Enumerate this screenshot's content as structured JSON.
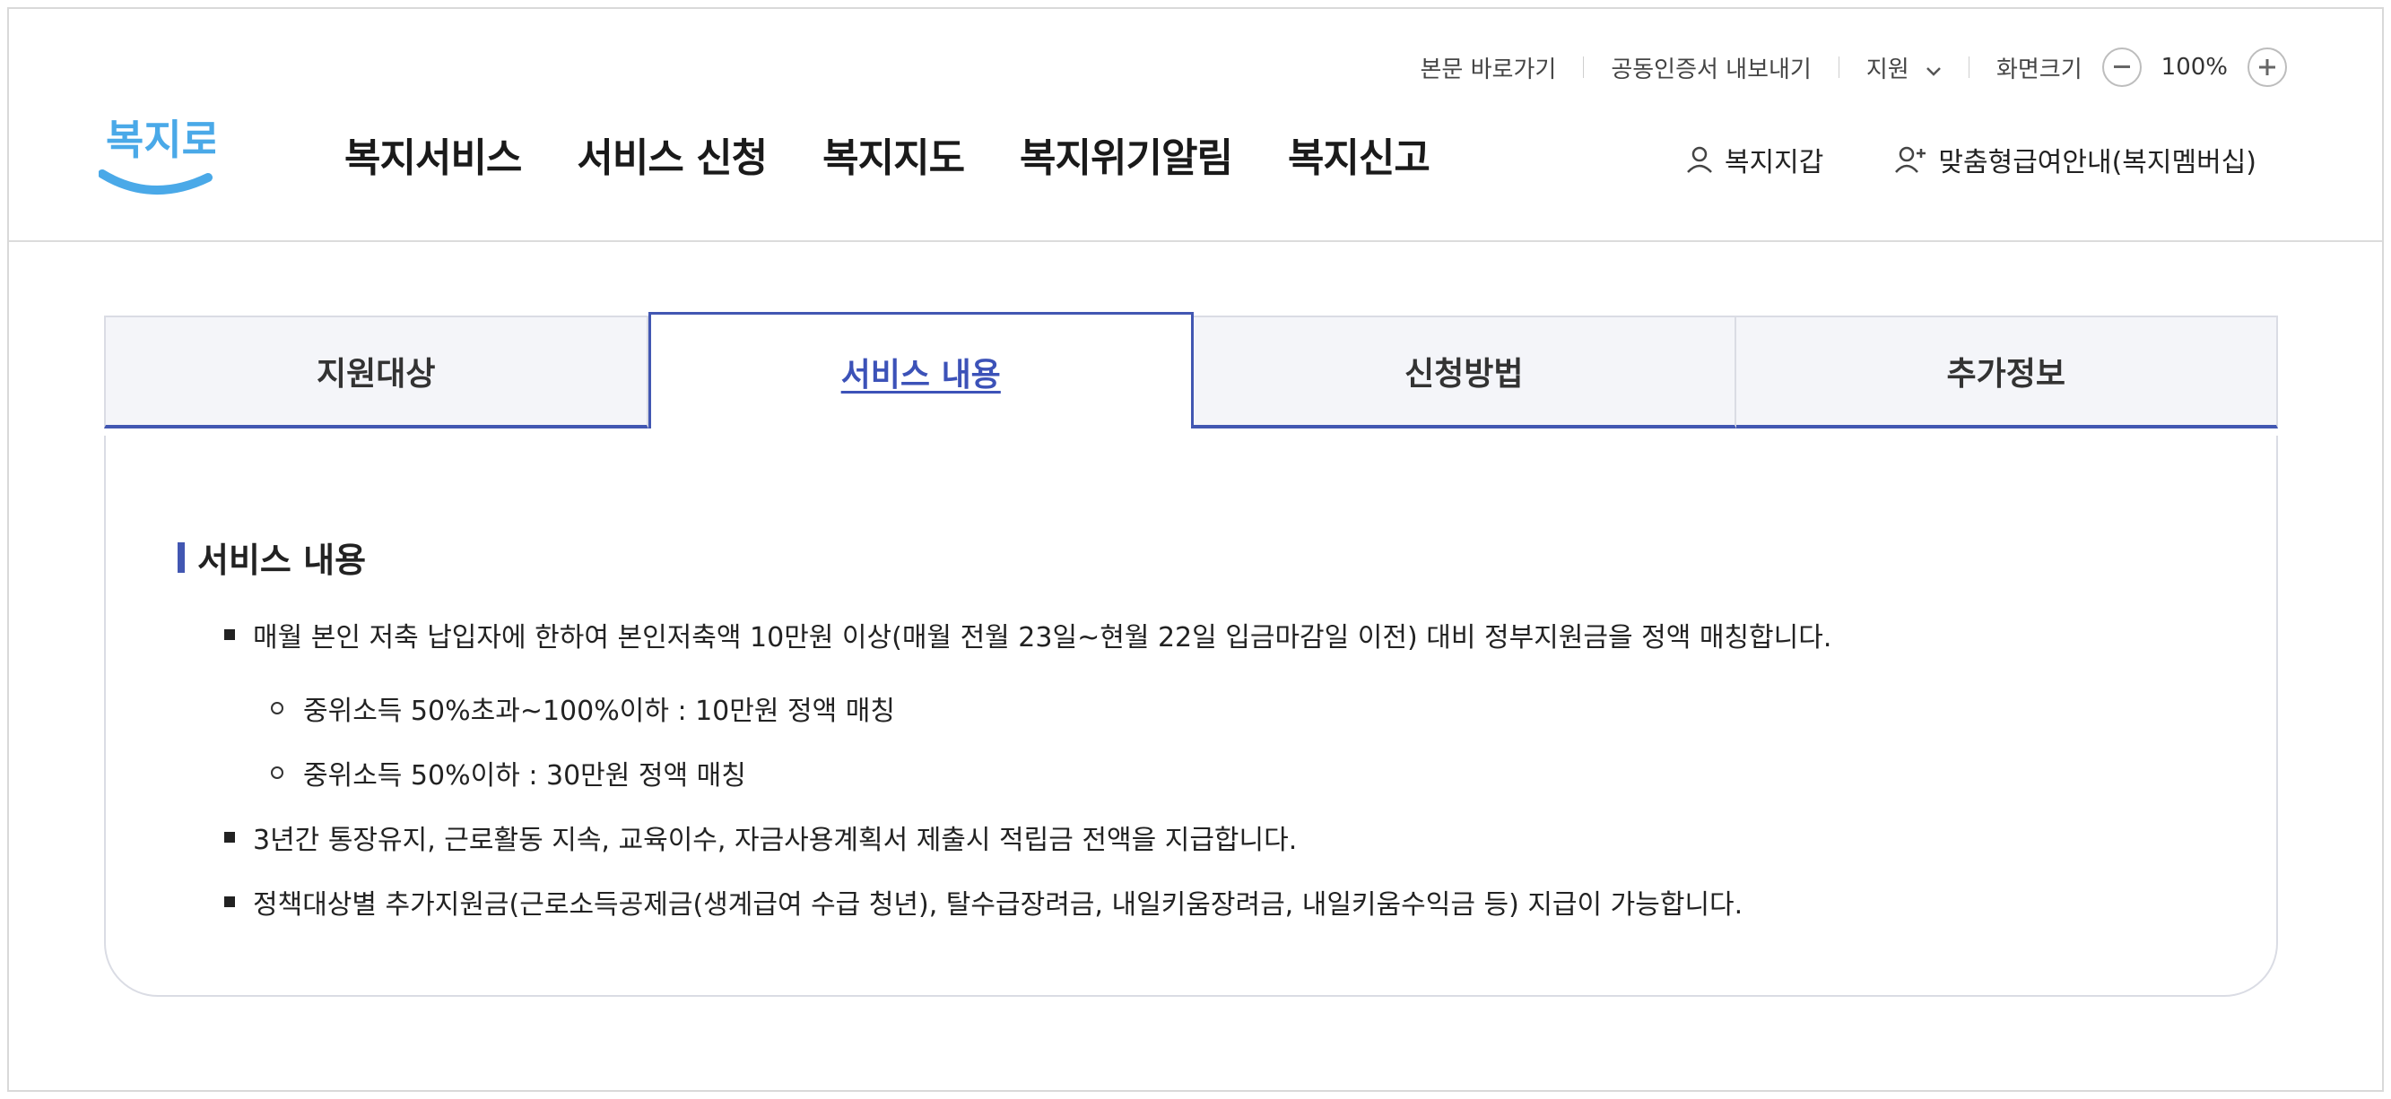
{
  "util": {
    "skip": "본문 바로가기",
    "cert": "공동인증서 내보내기",
    "support": "지원",
    "screen_size": "화면크기",
    "zoom": "100%"
  },
  "logo": {
    "text": "복지로"
  },
  "gnb": [
    "복지서비스",
    "서비스 신청",
    "복지지도",
    "복지위기알림",
    "복지신고"
  ],
  "user_links": {
    "wallet": "복지지갑",
    "membership": "맞춤형급여안내(복지멤버십)"
  },
  "tabs": [
    "지원대상",
    "서비스 내용",
    "신청방법",
    "추가정보"
  ],
  "section": {
    "title": "서비스 내용",
    "items": [
      "매월 본인 저축 납입자에 한하여 본인저축액 10만원 이상(매월 전월 23일~현월 22일 입금마감일 이전) 대비 정부지원금을 정액 매칭합니다.",
      "중위소득 50%초과~100%이하 : 10만원 정액 매칭",
      "중위소득 50%이하 : 30만원 정액 매칭",
      "3년간 통장유지, 근로활동 지속, 교육이수, 자금사용계획서 제출시 적립금 전액을 지급합니다.",
      "정책대상별 추가지원금(근로소득공제금(생계급여 수급 청년), 탈수급장려금, 내일키움장려금, 내일키움수익금 등) 지급이 가능합니다."
    ]
  },
  "colors": {
    "accent": "#4257b2",
    "logo": "#4aa9e8"
  }
}
